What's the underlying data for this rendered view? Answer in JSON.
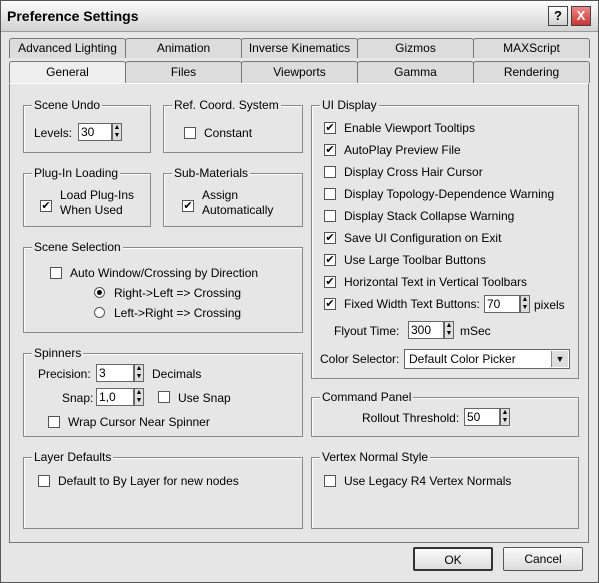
{
  "window": {
    "title": "Preference Settings",
    "help_label": "?",
    "close_label": "X"
  },
  "tabs_back": [
    "Advanced Lighting",
    "Animation",
    "Inverse Kinematics",
    "Gizmos",
    "MAXScript"
  ],
  "tabs_front": [
    "General",
    "Files",
    "Viewports",
    "Gamma",
    "Rendering"
  ],
  "scene_undo": {
    "title": "Scene Undo",
    "levels_label": "Levels:",
    "levels_value": "30"
  },
  "ref_coord": {
    "title": "Ref. Coord. System",
    "constant_label": "Constant",
    "constant_checked": false
  },
  "plugin_loading": {
    "title": "Plug-In Loading",
    "label_line1": "Load Plug-Ins",
    "label_line2": "When Used",
    "checked": true
  },
  "sub_materials": {
    "title": "Sub-Materials",
    "label_line1": "Assign",
    "label_line2": "Automatically",
    "checked": true
  },
  "scene_selection": {
    "title": "Scene Selection",
    "auto_window_label": "Auto Window/Crossing by Direction",
    "auto_window_checked": false,
    "radio1_label": "Right->Left => Crossing",
    "radio1_selected": true,
    "radio2_label": "Left->Right => Crossing",
    "radio2_selected": false
  },
  "spinners": {
    "title": "Spinners",
    "precision_label": "Precision:",
    "precision_value": "3",
    "decimals_label": "Decimals",
    "snap_label": "Snap:",
    "snap_value": "1,0",
    "use_snap_label": "Use Snap",
    "use_snap_checked": false,
    "wrap_cursor_label": "Wrap Cursor Near Spinner",
    "wrap_cursor_checked": false
  },
  "layer_defaults": {
    "title": "Layer Defaults",
    "default_label": "Default to By Layer for new nodes",
    "checked": false
  },
  "ui_display": {
    "title": "UI Display",
    "options": [
      {
        "label": "Enable Viewport Tooltips",
        "checked": true
      },
      {
        "label": "AutoPlay Preview File",
        "checked": true
      },
      {
        "label": "Display Cross Hair Cursor",
        "checked": false
      },
      {
        "label": "Display Topology-Dependence Warning",
        "checked": false
      },
      {
        "label": "Display Stack Collapse Warning",
        "checked": false
      },
      {
        "label": "Save UI Configuration on Exit",
        "checked": true
      },
      {
        "label": "Use Large Toolbar Buttons",
        "checked": true
      },
      {
        "label": "Horizontal Text in Vertical Toolbars",
        "checked": true
      }
    ],
    "fixed_width_label": "Fixed Width Text Buttons:",
    "fixed_width_checked": true,
    "fixed_width_value": "70",
    "pixels_label": "pixels",
    "flyout_label": "Flyout Time:",
    "flyout_value": "300",
    "msec_label": "mSec",
    "color_selector_label": "Color Selector:",
    "color_selector_value": "Default Color Picker"
  },
  "command_panel": {
    "title": "Command Panel",
    "rollout_label": "Rollout Threshold:",
    "rollout_value": "50"
  },
  "vertex_normal": {
    "title": "Vertex Normal Style",
    "legacy_label": "Use Legacy R4 Vertex Normals",
    "checked": false
  },
  "buttons": {
    "ok": "OK",
    "cancel": "Cancel"
  },
  "check_glyph": "✔"
}
